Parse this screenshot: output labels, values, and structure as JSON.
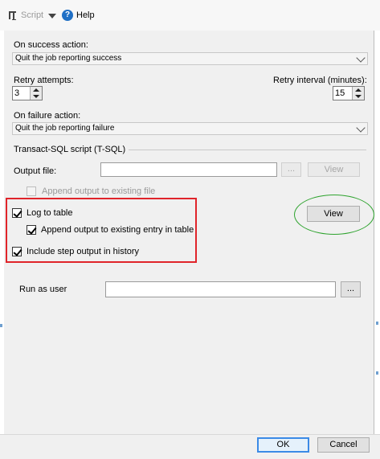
{
  "toolbar": {
    "script_label": "Script",
    "help_label": "Help",
    "script_icon": "script-icon",
    "help_icon": "help-circle-icon"
  },
  "on_success": {
    "label": "On success action:",
    "value": "Quit the job reporting success"
  },
  "retry_attempts": {
    "label": "Retry attempts:",
    "value": "3"
  },
  "retry_interval": {
    "label": "Retry interval (minutes):",
    "value": "15"
  },
  "on_failure": {
    "label": "On failure action:",
    "value": "Quit the job reporting failure"
  },
  "tsql_group": {
    "label": "Transact-SQL script (T-SQL)"
  },
  "output_file": {
    "label": "Output file:",
    "value": "",
    "browse_label": "...",
    "view_label": "View"
  },
  "append_existing_file": {
    "label": "Append output to existing file",
    "checked": false,
    "enabled": false
  },
  "log_to_table": {
    "label": "Log to table",
    "checked": true
  },
  "append_existing_entry": {
    "label": "Append output to existing entry in table",
    "checked": true
  },
  "include_step_output": {
    "label": "Include step output in history",
    "checked": true
  },
  "view_table_button": {
    "label": "View"
  },
  "run_as_user": {
    "label": "Run as user",
    "value": "",
    "browse_label": "..."
  },
  "footer": {
    "ok_label": "OK",
    "cancel_label": "Cancel"
  },
  "colors": {
    "highlight_red": "#e0242a",
    "highlight_green": "#2ea32e",
    "ok_border": "#3b8ae6"
  }
}
